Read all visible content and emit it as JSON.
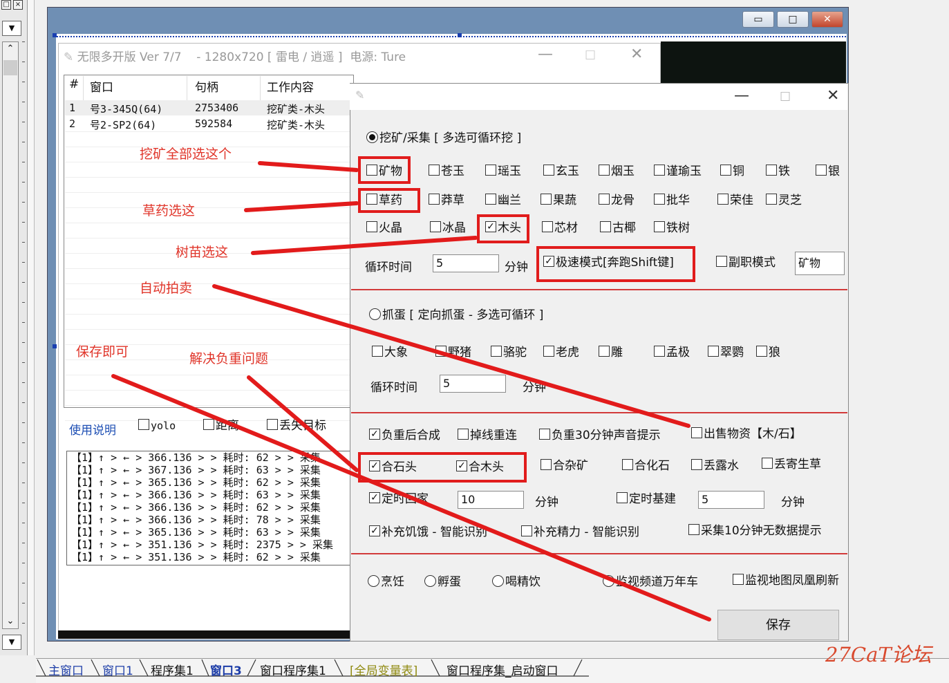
{
  "app_window": {
    "title": "无限多开版 Ver  7/7",
    "resolution": "- 1280x720 [ 雷电 / 逍遥 ]",
    "power": "电源: Ture",
    "list_headers": [
      "#",
      "窗口",
      "句柄",
      "工作内容"
    ],
    "rows": [
      {
        "idx": "1",
        "window": "号3-345Q(64)",
        "handle": "2753406",
        "job": "挖矿类-木头"
      },
      {
        "idx": "2",
        "window": "号2-SP2(64)",
        "handle": "592584",
        "job": "挖矿类-木头"
      }
    ],
    "usage_link": "使用说明",
    "opt_yolo": "yolo",
    "opt_distance": "距离",
    "opt_lost_target": "丢失目标",
    "log_lines": [
      "【1】↑ > ← > 366.136 > > 耗时: 62  > > 采集",
      "【1】↑ > ← > 367.136 > > 耗时: 63  > > 采集",
      "【1】↑ > ← > 365.136 > > 耗时: 62  > > 采集",
      "【1】↑ > ← > 366.136 > > 耗时: 63  > > 采集",
      "【1】↑ > ← > 366.136 > > 耗时: 62  > > 采集",
      "【1】↑ > ← > 366.136 > > 耗时: 78  > > 采集",
      "【1】↑ > ← > 365.136 > > 耗时: 63  > > 采集",
      "【1】↑ > ← > 351.136 > > 耗时: 2375  > > 采集",
      "【1】↑ > ← > 351.136 > > 耗时: 62  > > 采集"
    ]
  },
  "settings": {
    "mining_radio": "挖矿/采集 [ 多选可循环挖 ]",
    "mining_row1": [
      "矿物",
      "苍玉",
      "瑶玉",
      "玄玉",
      "烟玉",
      "谨瑜玉",
      "铜",
      "铁",
      "银"
    ],
    "mining_row2": [
      "草药",
      "莽草",
      "幽兰",
      "果蔬",
      "龙骨",
      "批华",
      "荣佳",
      "灵芝"
    ],
    "mining_row3": [
      "火晶",
      "冰晶",
      "木头",
      "芯材",
      "古椰",
      "铁树"
    ],
    "cycle_label": "循环时间",
    "cycle_value": "5",
    "minutes": "分钟",
    "speed_mode": "极速模式[奔跑Shift键]",
    "sub_mode": "副职模式",
    "sub_mode_value": "矿物",
    "egg_radio": "抓蛋 [ 定向抓蛋 - 多选可循环 ]",
    "egg_animals": [
      "大象",
      "野猪",
      "骆驼",
      "老虎",
      "雕",
      "孟极",
      "翠鹦",
      "狼"
    ],
    "egg_cycle_label": "循环时间",
    "egg_cycle_value": "5",
    "egg_minutes": "分钟",
    "opt_synth": "负重后合成",
    "opt_reconnect": "掉线重连",
    "opt_sound": "负重30分钟声音提示",
    "opt_sell": "出售物资【木/石】",
    "opt_stone": "合石头",
    "opt_wood": "合木头",
    "opt_misc": "合杂矿",
    "opt_fossil": "合化石",
    "opt_dew": "丢露水",
    "opt_parasite": "丢寄生草",
    "opt_home": "定时回家",
    "home_value": "10",
    "home_minutes": "分钟",
    "opt_build": "定时基建",
    "build_value": "5",
    "build_minutes": "分钟",
    "opt_hunger": "补充饥饿 - 智能识别",
    "opt_energy": "补充精力 - 智能识别",
    "opt_nodata": "采集10分钟无数据提示",
    "radio_cook": "烹饪",
    "radio_hatch": "孵蛋",
    "radio_drink": "喝精饮",
    "radio_monitor": "监视频道万年车",
    "opt_phoenix": "监视地图凤凰刷新",
    "save": "保存"
  },
  "annotations": {
    "a1": "挖矿全部选这个",
    "a2": "草药选这",
    "a3": "树苗选这",
    "a4": "自动拍卖",
    "a5": "保存即可",
    "a6": "解决负重问题"
  },
  "tabs": [
    "主窗口",
    "窗口1",
    "程序集1",
    "窗口3",
    "窗口程序集1",
    "[全局变量表]",
    "窗口程序集_启动窗口"
  ],
  "watermark": "27CaT论坛",
  "colors": {
    "annotation": "#e0352a",
    "ide_frame": "#6f8fb4",
    "link": "#1e4fb4"
  }
}
